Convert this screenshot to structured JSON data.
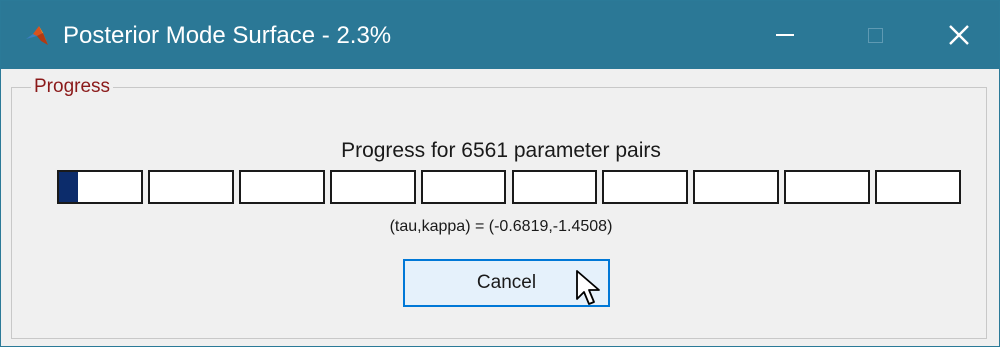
{
  "window": {
    "title": "Posterior Mode Surface - 2.3%",
    "app_icon": "matlab-icon",
    "controls": {
      "minimize_icon": "minimize-icon",
      "maximize_icon": "maximize-icon",
      "close_icon": "close-icon",
      "close_glyph": "✕"
    }
  },
  "group": {
    "legend": "Progress"
  },
  "progress": {
    "title": "Progress for 6561 parameter pairs",
    "segments": 10,
    "fraction": 0.023,
    "fill_color": "#0c2c6b",
    "coords_text": "(tau,kappa) = (-0.6819,-1.4508)"
  },
  "actions": {
    "cancel_label": "Cancel"
  },
  "colors": {
    "titlebar": "#2b7896",
    "legend_text": "#8b1a1a",
    "button_border": "#0078d7",
    "button_bg": "#e5f1fb"
  }
}
